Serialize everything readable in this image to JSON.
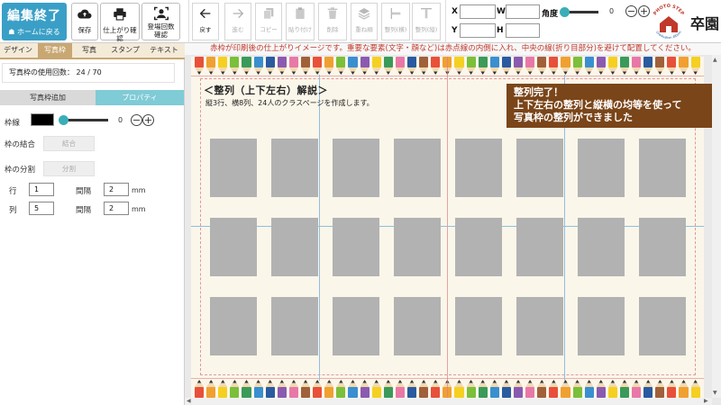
{
  "toolbar": {
    "finish_label": "編集終了",
    "home_label": "ホームに戻る",
    "save_label": "保存",
    "preview_label": "仕上がり確認",
    "preview_sub": "⌄",
    "count_label": "登場回数確認",
    "undo_label": "戻す",
    "redo_label": "進む",
    "copy_label": "コピー",
    "paste_label": "貼り付け",
    "delete_label": "削除",
    "order_label": "重ね順",
    "align_h_label": "整列(横)",
    "align_v_label": "整列(縦)",
    "x_label": "X",
    "w_label": "W",
    "y_label": "Y",
    "h_label": "H",
    "angle_label": "角度",
    "angle_value": "0",
    "minus": "−",
    "plus": "+"
  },
  "brand": {
    "logo_arc_top": "PHOTO STEP",
    "logo_arc_bottom": "Graduation Album",
    "name": "卒園"
  },
  "notice": "赤枠が印刷後の仕上がりイメージです。重要な要素(文字・顔など)は赤点線の内側に入れ、中央の線(折り目部分)を避けて配置してください。",
  "left_panel": {
    "tabs": [
      {
        "label": "デザイン",
        "active": false
      },
      {
        "label": "写真枠",
        "active": true
      },
      {
        "label": "写真",
        "active": false
      },
      {
        "label": "スタンプ",
        "active": false
      },
      {
        "label": "テキスト",
        "active": false
      }
    ],
    "usage_label": "写真枠の使用回数：",
    "usage_value": "24 / 70",
    "subtabs": [
      {
        "label": "写真枠追加",
        "active": false
      },
      {
        "label": "プロパティ",
        "active": true
      }
    ],
    "border_label": "枠線",
    "border_value": "0",
    "border_color": "#000000",
    "merge_label": "枠の結合",
    "merge_button": "結合",
    "split_label": "枠の分割",
    "split_button": "分割",
    "row_label": "行",
    "row_value": "1",
    "row_gap_label": "間隔",
    "row_gap_value": "2",
    "row_unit": "mm",
    "col_label": "列",
    "col_value": "5",
    "col_gap_label": "間隔",
    "col_gap_value": "2",
    "col_unit": "mm"
  },
  "canvas": {
    "heading": "＜整列（上下左右）解説＞",
    "subheading": "縦3行、横8列、24人のクラスページを作成します。",
    "banner_lines": [
      "整列完了！",
      "上下左右の整列と縦横の均等を使って",
      "写真枠の整列ができました"
    ],
    "rows": 3,
    "cols": 8
  },
  "colors": {
    "accent": "#3a9fc6",
    "tab_accent": "#c9a772",
    "subtab_accent": "#7fcbd6",
    "banner_bg": "#7a4519",
    "notice_text": "#c0392b",
    "photo_placeholder": "#b2b2b2",
    "pencils": [
      "#e8503a",
      "#f0a030",
      "#f5d020",
      "#7bbf3a",
      "#3a9a5a",
      "#3a8fd0",
      "#2a5aa0",
      "#8a5ab0",
      "#e878a8",
      "#a0603a",
      "#e8503a",
      "#f0a030",
      "#7bbf3a",
      "#3a8fd0",
      "#8a5ab0",
      "#f5d020",
      "#3a9a5a",
      "#e878a8",
      "#2a5aa0",
      "#a0603a",
      "#e8503a",
      "#f0a030",
      "#f5d020",
      "#7bbf3a",
      "#3a9a5a",
      "#3a8fd0",
      "#2a5aa0",
      "#8a5ab0",
      "#e878a8",
      "#a0603a",
      "#e8503a",
      "#f0a030",
      "#7bbf3a",
      "#3a8fd0",
      "#8a5ab0",
      "#f5d020",
      "#3a9a5a",
      "#e878a8",
      "#2a5aa0",
      "#a0603a",
      "#e8503a",
      "#f0a030",
      "#f5d020"
    ]
  },
  "icons": {
    "save": "cloud-upload-icon",
    "preview": "printer-icon",
    "count": "person-frame-icon",
    "undo": "arrow-left-icon",
    "redo": "arrow-right-icon",
    "copy": "copy-icon",
    "paste": "clipboard-icon",
    "delete": "trash-icon",
    "order": "layers-icon",
    "align_h": "align-horizontal-icon",
    "align_v": "align-vertical-icon"
  }
}
